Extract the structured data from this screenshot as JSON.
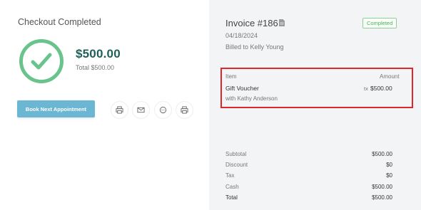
{
  "checkout": {
    "title": "Checkout Completed",
    "amount": "$500.00",
    "total_label": "Total $500.00",
    "book_button": "Book Next Appointment"
  },
  "icons": [
    "check-circle-icon",
    "print-icon",
    "mail-icon",
    "chat-icon",
    "print-icon"
  ],
  "invoice": {
    "title": "Invoice #186",
    "status": "Completed",
    "date": "04/18/2024",
    "billed_to": "Billed to Kelly Young",
    "columns": {
      "item": "Item",
      "amount": "Amount"
    },
    "items": [
      {
        "name": "Gift Voucher",
        "tax": "tx",
        "price": "$500.00",
        "staff": "with Kathy Anderson"
      }
    ],
    "summary": [
      {
        "label": "Subtotal",
        "value": "$500.00"
      },
      {
        "label": "Discount",
        "value": "$0"
      },
      {
        "label": "Tax",
        "value": "$0"
      },
      {
        "label": "Cash",
        "value": "$500.00"
      },
      {
        "label": "Total",
        "value": "$500.00"
      }
    ]
  },
  "colors": {
    "success_green": "#68c38c",
    "amount_teal": "#1f5f58",
    "button_blue": "#6bb7d3",
    "highlight_red": "#e0262c"
  }
}
